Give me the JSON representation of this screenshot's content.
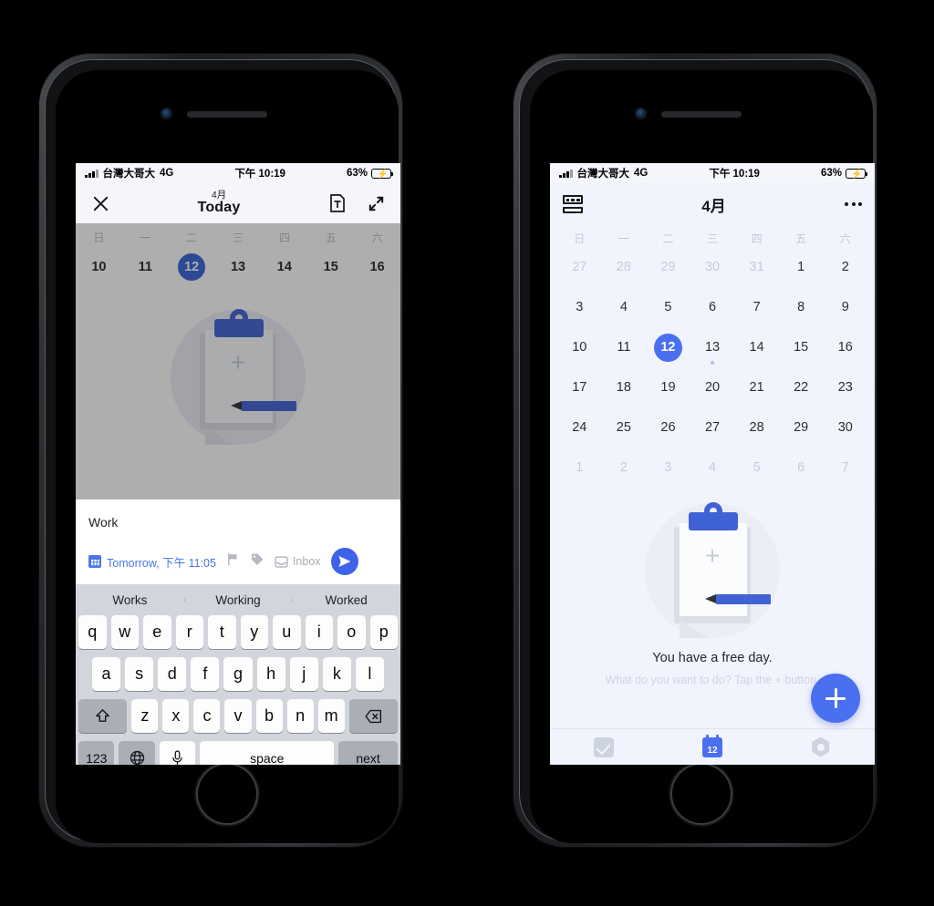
{
  "status_bar": {
    "carrier": "台灣大哥大",
    "network": "4G",
    "time": "下午 10:19",
    "battery_percent": "63%",
    "signal_icon": "signal-bars-icon",
    "battery_icon": "battery-charging-icon"
  },
  "left_phone": {
    "header": {
      "close_icon": "close-icon",
      "month": "4月",
      "title": "Today",
      "template_icon": "text-template-icon",
      "expand_icon": "expand-icon"
    },
    "week_strip": {
      "weekdays": [
        "日",
        "一",
        "二",
        "三",
        "四",
        "五",
        "六"
      ],
      "days": [
        "10",
        "11",
        "12",
        "13",
        "14",
        "15",
        "16"
      ],
      "selected": "12"
    },
    "illustration": {
      "name": "empty-clipboard-illustration",
      "plus": "+"
    },
    "quick_add": {
      "task_text": "Work",
      "date_label": "Tomorrow, 下午 11:05",
      "calendar_icon": "calendar-icon",
      "flag_icon": "flag-icon",
      "tag_icon": "tag-icon",
      "inbox_icon": "inbox-icon",
      "inbox_label": "Inbox",
      "send_icon": "send-icon"
    },
    "keyboard": {
      "suggestions": [
        "Works",
        "Working",
        "Worked"
      ],
      "row1": [
        "q",
        "w",
        "e",
        "r",
        "t",
        "y",
        "u",
        "i",
        "o",
        "p"
      ],
      "row2": [
        "a",
        "s",
        "d",
        "f",
        "g",
        "h",
        "j",
        "k",
        "l"
      ],
      "row3": [
        "z",
        "x",
        "c",
        "v",
        "b",
        "n",
        "m"
      ],
      "shift_icon": "shift-icon",
      "backspace_icon": "backspace-icon",
      "numbers_label": "123",
      "globe_icon": "globe-icon",
      "mic_icon": "microphone-icon",
      "space_label": "space",
      "return_label": "next"
    }
  },
  "right_phone": {
    "header": {
      "view_icon": "layout-grid-icon",
      "title": "4月",
      "more_icon": "more-options-icon"
    },
    "calendar": {
      "weekdays": [
        "日",
        "一",
        "二",
        "三",
        "四",
        "五",
        "六"
      ],
      "weeks": [
        [
          {
            "d": "27",
            "muted": true
          },
          {
            "d": "28",
            "muted": true
          },
          {
            "d": "29",
            "muted": true
          },
          {
            "d": "30",
            "muted": true
          },
          {
            "d": "31",
            "muted": true
          },
          {
            "d": "1",
            "muted": false
          },
          {
            "d": "2",
            "muted": false
          }
        ],
        [
          {
            "d": "3",
            "muted": false
          },
          {
            "d": "4",
            "muted": false
          },
          {
            "d": "5",
            "muted": false
          },
          {
            "d": "6",
            "muted": false
          },
          {
            "d": "7",
            "muted": false
          },
          {
            "d": "8",
            "muted": false
          },
          {
            "d": "9",
            "muted": false
          }
        ],
        [
          {
            "d": "10",
            "muted": false
          },
          {
            "d": "11",
            "muted": false
          },
          {
            "d": "12",
            "muted": false,
            "selected": true
          },
          {
            "d": "13",
            "muted": false,
            "dot": true
          },
          {
            "d": "14",
            "muted": false
          },
          {
            "d": "15",
            "muted": false
          },
          {
            "d": "16",
            "muted": false
          }
        ],
        [
          {
            "d": "17",
            "muted": false
          },
          {
            "d": "18",
            "muted": false
          },
          {
            "d": "19",
            "muted": false
          },
          {
            "d": "20",
            "muted": false
          },
          {
            "d": "21",
            "muted": false
          },
          {
            "d": "22",
            "muted": false
          },
          {
            "d": "23",
            "muted": false
          }
        ],
        [
          {
            "d": "24",
            "muted": false
          },
          {
            "d": "25",
            "muted": false
          },
          {
            "d": "26",
            "muted": false
          },
          {
            "d": "27",
            "muted": false
          },
          {
            "d": "28",
            "muted": false
          },
          {
            "d": "29",
            "muted": false
          },
          {
            "d": "30",
            "muted": false
          }
        ],
        [
          {
            "d": "1",
            "muted": true
          },
          {
            "d": "2",
            "muted": true
          },
          {
            "d": "3",
            "muted": true
          },
          {
            "d": "4",
            "muted": true
          },
          {
            "d": "5",
            "muted": true
          },
          {
            "d": "6",
            "muted": true
          },
          {
            "d": "7",
            "muted": true
          }
        ]
      ]
    },
    "empty_state": {
      "illustration": "empty-clipboard-illustration",
      "plus": "+",
      "title": "You have a free day.",
      "subtitle": "What do you want to do? Tap the + button."
    },
    "fab": {
      "icon": "add-icon"
    },
    "tab_bar": {
      "tabs": [
        {
          "name": "tab-tasks",
          "icon": "checkbox-icon",
          "active": false
        },
        {
          "name": "tab-calendar",
          "icon": "calendar-12-icon",
          "label": "12",
          "active": true
        },
        {
          "name": "tab-settings",
          "icon": "settings-gear-icon",
          "active": false
        }
      ]
    }
  },
  "colors": {
    "accent_blue": "#4a6ff0",
    "deep_blue": "#3563d6",
    "calendar_bg": "#f1f4fd",
    "battery_green": "#37d04a",
    "muted_gray": "#c6cbd8"
  }
}
